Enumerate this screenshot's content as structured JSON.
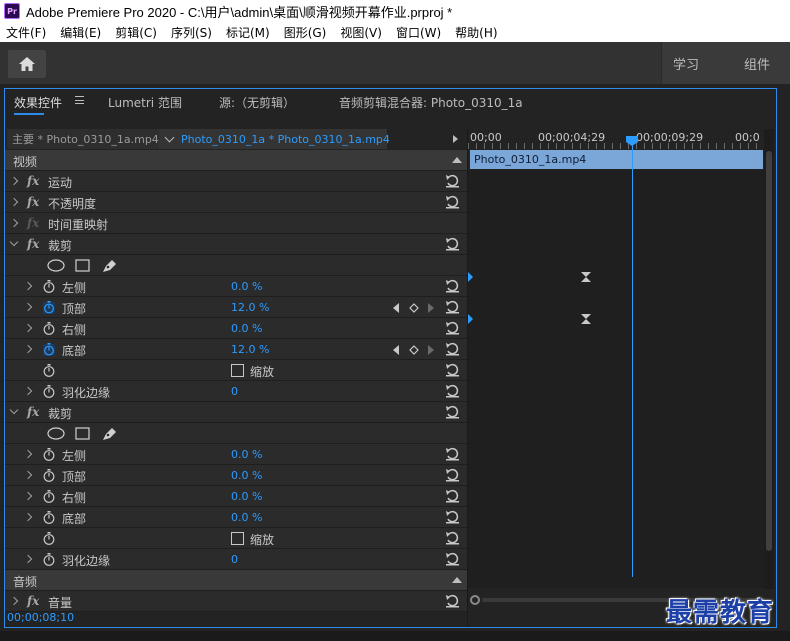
{
  "window": {
    "title": "Adobe Premiere Pro 2020 - C:\\用户\\admin\\桌面\\顺滑视频开幕作业.prproj *",
    "logo": "Pr"
  },
  "menubar": [
    "文件(F)",
    "编辑(E)",
    "剪辑(C)",
    "序列(S)",
    "标记(M)",
    "图形(G)",
    "视图(V)",
    "窗口(W)",
    "帮助(H)"
  ],
  "workspaces": {
    "learn": "学习",
    "assembly": "组件"
  },
  "panel_tabs": {
    "effect_controls": "效果控件",
    "lumetri": "Lumetri 范围",
    "source": "源:（无剪辑）",
    "audio_mixer": "音频剪辑混合器: Photo_0310_1a"
  },
  "clip_bar": {
    "master": "主要 * Photo_0310_1a.mp4",
    "sequence": "Photo_0310_1a * Photo_0310_1a.mp4"
  },
  "timeline": {
    "ticks": [
      "00;00",
      "00;00;04;29",
      "00;00;09;29",
      "00;0"
    ],
    "clip_name": "Photo_0310_1a.mp4",
    "playhead_fraction": 0.555
  },
  "sections": {
    "video": "视频",
    "audio": "音频"
  },
  "effects": {
    "motion": "运动",
    "opacity": "不透明度",
    "time_remap": "时间重映射",
    "crop": "裁剪",
    "volume": "音量"
  },
  "crop1": {
    "left": {
      "label": "左侧",
      "value": "0.0 %"
    },
    "top": {
      "label": "顶部",
      "value": "12.0 %"
    },
    "right": {
      "label": "右侧",
      "value": "0.0 %"
    },
    "bottom": {
      "label": "底部",
      "value": "12.0 %"
    },
    "zoom": {
      "label": "缩放"
    },
    "feather": {
      "label": "羽化边缘",
      "value": "0"
    }
  },
  "crop2": {
    "left": {
      "label": "左侧",
      "value": "0.0 %"
    },
    "top": {
      "label": "顶部",
      "value": "0.0 %"
    },
    "right": {
      "label": "右侧",
      "value": "0.0 %"
    },
    "bottom": {
      "label": "底部",
      "value": "0.0 %"
    },
    "zoom": {
      "label": "缩放"
    },
    "feather": {
      "label": "羽化边缘",
      "value": "0"
    }
  },
  "timecode": "00;00;08;10",
  "watermark": "最需教育",
  "colors": {
    "accent": "#2d9cff",
    "clip": "#7aa6d8",
    "panel_border": "#2d8ceb"
  }
}
